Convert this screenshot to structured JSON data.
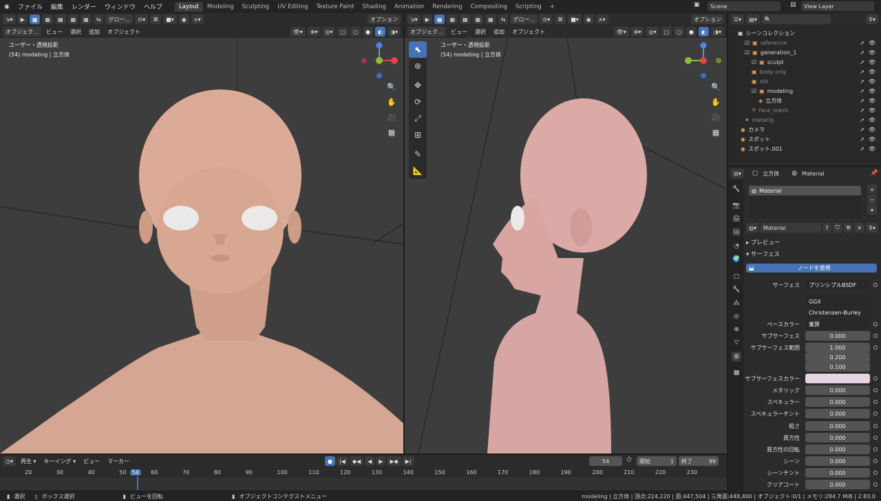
{
  "topbar": {
    "menus": [
      "ファイル",
      "編集",
      "レンダー",
      "ウィンドウ",
      "ヘルプ"
    ],
    "tabs": [
      "Layout",
      "Modeling",
      "Sculpting",
      "UV Editing",
      "Texture Paint",
      "Shading",
      "Animation",
      "Rendering",
      "Compositing",
      "Scripting"
    ],
    "add_tab": "+",
    "scene": "Scene",
    "view_layer": "View Layer"
  },
  "left_view": {
    "orientation": "グロー…",
    "options": "オプション",
    "mode": "オブジェク…",
    "menus": [
      "ビュー",
      "選択",
      "追加",
      "オブジェクト"
    ],
    "title": "ユーザー・透視投影",
    "subtitle": "(54) modeling | 立方体"
  },
  "right_view": {
    "orientation": "グロー…",
    "options": "オプション",
    "mode": "オブジェク…",
    "menus": [
      "ビュー",
      "選択",
      "追加",
      "オブジェクト"
    ],
    "title": "ユーザー・透視投影",
    "subtitle": "(54) modeling | 立方体"
  },
  "outliner": {
    "root": "シーンコレクション",
    "rows": [
      {
        "label": "reference",
        "dim": true
      },
      {
        "label": "generation_1",
        "dim": false
      },
      {
        "label": "sculpt",
        "dim": false
      },
      {
        "label": "body-orig",
        "dim": true
      },
      {
        "label": "old",
        "dim": true
      },
      {
        "label": "modeling",
        "dim": false
      },
      {
        "label": "立方体",
        "dim": false
      },
      {
        "label": "face_mesh",
        "dim": true
      },
      {
        "label": "metarig",
        "dim": true
      },
      {
        "label": "カメラ",
        "dim": false
      },
      {
        "label": "スポット",
        "dim": false
      },
      {
        "label": "スポット.001",
        "dim": false
      }
    ]
  },
  "properties": {
    "object_name": "立方体",
    "material_tab": "Material",
    "slot": "Material",
    "material_name": "Material",
    "users": "7",
    "preview": "プレビュー",
    "surface": "サーフェス",
    "use_nodes": "ノードを使用",
    "surface_label": "サーフェス",
    "surface_value": "プリンシプルBSDF",
    "distribution": "GGX",
    "sss_method": "Christensen-Burley",
    "rows": [
      {
        "label": "ベースカラー",
        "value": "乗算"
      },
      {
        "label": "サブサーフェス",
        "value": "0.000"
      },
      {
        "label": "サブサーフェス範囲",
        "value": "1.000"
      },
      {
        "label": "",
        "value": "0.200"
      },
      {
        "label": "",
        "value": "0.100"
      },
      {
        "label": "サブサーフェスカラー",
        "value": ""
      },
      {
        "label": "メタリック",
        "value": "0.000"
      },
      {
        "label": "スペキュラー",
        "value": "0.000"
      },
      {
        "label": "スペキュラーチント",
        "value": "0.000"
      },
      {
        "label": "粗さ",
        "value": "0.000"
      },
      {
        "label": "異方性",
        "value": "0.000"
      },
      {
        "label": "異方性の回転",
        "value": "0.000"
      },
      {
        "label": "シーン",
        "value": "0.000"
      },
      {
        "label": "シーンチント",
        "value": "0.000"
      },
      {
        "label": "クリアコート",
        "value": "0.000"
      }
    ]
  },
  "timeline": {
    "menus": [
      "再生",
      "キーイング",
      "ビュー",
      "マーカー"
    ],
    "frame": "54",
    "start_label": "開始",
    "start": "1",
    "end_label": "終了",
    "end": "99",
    "ticks": [
      "20",
      "30",
      "40",
      "50",
      "54",
      "60",
      "70",
      "80",
      "90",
      "100",
      "110",
      "120",
      "130",
      "140",
      "150",
      "160",
      "170",
      "180",
      "190",
      "200",
      "210",
      "220",
      "230"
    ]
  },
  "status": {
    "select": "選択",
    "box": "ボックス選択",
    "rotate": "ビューを回転",
    "context": "オブジェクトコンテクストメニュー",
    "stats": "modeling | 立方体 | 頂点:224,220 | 面:447,504 | 三角面:448,400 | オブジェクト:0/1 | メモリ:284.7 MiB | 2.83.0"
  },
  "colors": {
    "accent": "#4772b3",
    "skin": "#d8a996",
    "sss_color": "#e9d5e2"
  }
}
